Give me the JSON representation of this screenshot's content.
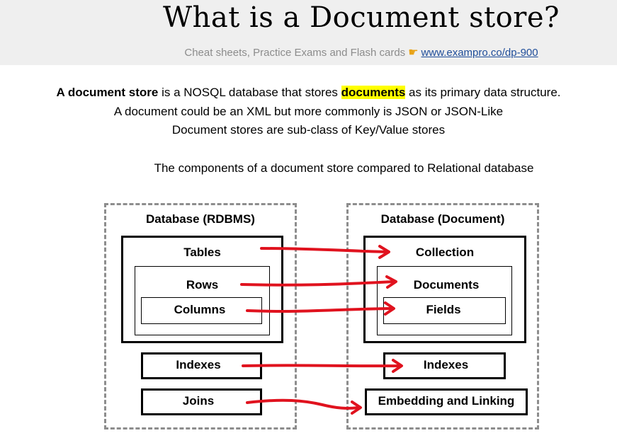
{
  "header": {
    "title": "What is a Document store?",
    "subtitle": "Cheat sheets, Practice Exams and Flash cards",
    "pointer_icon": "pointing-hand-icon",
    "link": "www.exampro.co/dp-900"
  },
  "intro": {
    "line1_bold": "A document store",
    "line1_mid": " is a NOSQL database that stores ",
    "line1_highlight": "documents",
    "line1_end": " as its primary data structure.",
    "line2": "A document could be an XML but more commonly is JSON or JSON-Like",
    "line3": "Document stores are sub-class of Key/Value stores",
    "components": "The components of a document store compared to Relational database"
  },
  "rdbms": {
    "title": "Database (RDBMS)",
    "tables": "Tables",
    "rows": "Rows",
    "columns": "Columns",
    "indexes": "Indexes",
    "joins": "Joins"
  },
  "document": {
    "title": "Database (Document)",
    "collection": "Collection",
    "documents": "Documents",
    "fields": "Fields",
    "indexes": "Indexes",
    "embedding": "Embedding and Linking"
  },
  "colors": {
    "arrow": "#e0121e",
    "highlight": "#ffff00",
    "link": "#1f4e9a",
    "dashed_border": "#8d8d8d"
  }
}
